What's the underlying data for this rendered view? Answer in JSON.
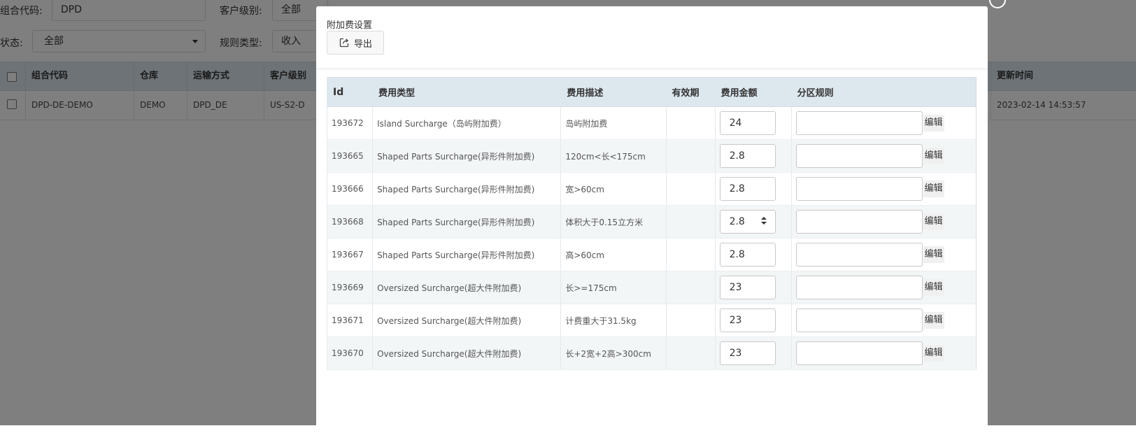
{
  "background": {
    "filters": {
      "combo_code_label": "组合代码:",
      "combo_code_value": "DPD",
      "customer_level_label": "客户级别:",
      "customer_level_value": "全部",
      "status_label": "状态:",
      "status_value": "全部",
      "rule_type_label": "规则类型:",
      "rule_type_value": "收入"
    },
    "table": {
      "headers": {
        "combo_code": "组合代码",
        "warehouse": "仓库",
        "shipping_method": "运输方式",
        "customer_level": "客户级别",
        "update_time": "更新时间"
      },
      "row": {
        "combo_code": "DPD-DE-DEMO",
        "warehouse": "DEMO",
        "shipping_method": "DPD_DE",
        "customer_level": "US-S2-D",
        "update_time": "2023-02-14 14:53:57"
      }
    }
  },
  "modal": {
    "title": "附加费设置",
    "export_label": "导出",
    "headers": {
      "id": "Id",
      "fee_type": "费用类型",
      "fee_desc": "费用描述",
      "validity": "有效期",
      "amount": "费用金额",
      "zone_rule": "分区规则"
    },
    "edit_label": "编辑",
    "rows": [
      {
        "id": "193672",
        "fee_type": "Island Surcharge（岛屿附加费）",
        "fee_desc": "岛屿附加费",
        "validity": "",
        "amount": "24",
        "zone_rule": ""
      },
      {
        "id": "193665",
        "fee_type": "Shaped Parts Surcharge(异形件附加费)",
        "fee_desc": "120cm<长<175cm",
        "validity": "",
        "amount": "2.8",
        "zone_rule": ""
      },
      {
        "id": "193666",
        "fee_type": "Shaped Parts Surcharge(异形件附加费)",
        "fee_desc": "宽>60cm",
        "validity": "",
        "amount": "2.8",
        "zone_rule": ""
      },
      {
        "id": "193668",
        "fee_type": "Shaped Parts Surcharge(异形件附加费)",
        "fee_desc": "体积大于0.15立方米",
        "validity": "",
        "amount": "2.8",
        "zone_rule": ""
      },
      {
        "id": "193667",
        "fee_type": "Shaped Parts Surcharge(异形件附加费)",
        "fee_desc": "高>60cm",
        "validity": "",
        "amount": "2.8",
        "zone_rule": ""
      },
      {
        "id": "193669",
        "fee_type": "Oversized Surcharge(超大件附加费)",
        "fee_desc": "长>=175cm",
        "validity": "",
        "amount": "23",
        "zone_rule": ""
      },
      {
        "id": "193671",
        "fee_type": "Oversized Surcharge(超大件附加费)",
        "fee_desc": "计费重大于31.5kg",
        "validity": "",
        "amount": "23",
        "zone_rule": ""
      },
      {
        "id": "193670",
        "fee_type": "Oversized Surcharge(超大件附加费)",
        "fee_desc": "长+2宽+2高>300cm",
        "validity": "",
        "amount": "23",
        "zone_rule": ""
      }
    ]
  }
}
